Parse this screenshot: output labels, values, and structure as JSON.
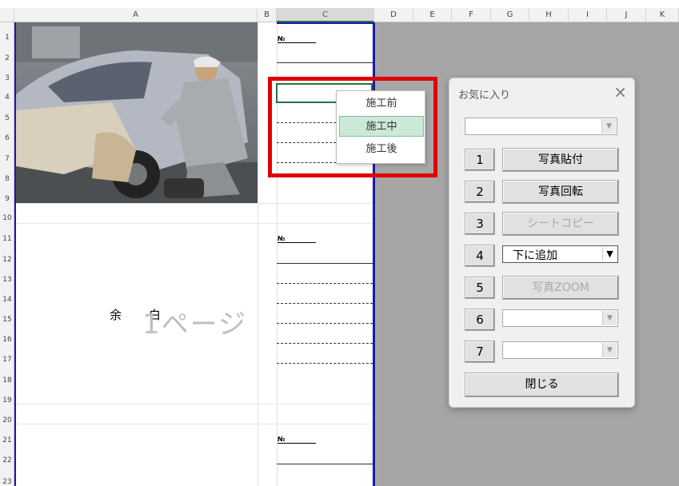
{
  "spreadsheet": {
    "columns": [
      "A",
      "B",
      "C",
      "D",
      "E",
      "F",
      "G",
      "H",
      "I",
      "J",
      "K"
    ],
    "rows": [
      "1",
      "2",
      "3",
      "4",
      "5",
      "6",
      "7",
      "8",
      "9",
      "10",
      "11",
      "12",
      "13",
      "14",
      "15",
      "16",
      "17",
      "18",
      "19",
      "20",
      "21",
      "22",
      "23"
    ],
    "block_no_label": "№",
    "margin_label_1": "余",
    "margin_label_2": "白",
    "page_label": "1ページ"
  },
  "cell_dropdown": {
    "options": [
      "施工前",
      "施工中",
      "施工後"
    ],
    "highlighted": "施工中"
  },
  "dialog": {
    "title": "お気に入り",
    "close": "×",
    "top_combo_value": "",
    "buttons": [
      {
        "num": "1",
        "label": "写真貼付",
        "enabled": true
      },
      {
        "num": "2",
        "label": "写真回転",
        "enabled": true
      },
      {
        "num": "3",
        "label": "シートコピー",
        "enabled": false
      },
      {
        "num": "4",
        "label": "下に追加",
        "type": "combo"
      },
      {
        "num": "5",
        "label": "写真ZOOM",
        "enabled": false
      },
      {
        "num": "6",
        "label": "",
        "type": "combo"
      },
      {
        "num": "7",
        "label": "",
        "type": "combo"
      }
    ],
    "close_button": "閉じる"
  },
  "colors": {
    "accent": "#217346",
    "highlight_border": "#e00000",
    "print_border": "#1a1aa8"
  }
}
